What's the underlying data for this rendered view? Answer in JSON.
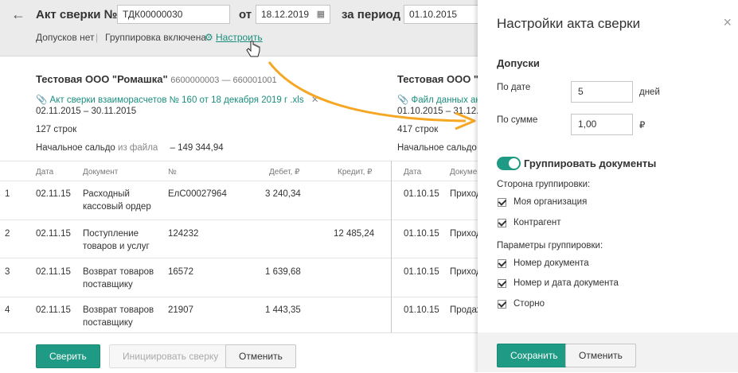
{
  "header": {
    "title": "Акт сверки №",
    "act_number": "ТДК00000030",
    "from_label": "от",
    "date": "18.12.2019",
    "period_label": "за период",
    "period_start": "01.10.2015",
    "tolerances_status": "Допусков нет",
    "separator": "|",
    "grouping_status": "Группировка включена",
    "configure_link": "Настроить"
  },
  "left_org": {
    "name": "Тестовая ООО \"Ромашка\"",
    "inn": "6600000003 — 660001001",
    "file": "Акт сверки взаиморасчетов № 160 от 18 декабря 2019 г .xls",
    "period": "02.11.2015 – 30.11.2015",
    "rows": "127 строк",
    "balance_label": "Начальное сальдо",
    "balance_source": "из файла",
    "balance_value": "– 149 344,94"
  },
  "right_org": {
    "name": "Тестовая ООО \"В",
    "file": "Файл данных акт",
    "period": "01.10.2015 – 31.12.20",
    "rows": "417 строк",
    "balance_label": "Начальное сальдо и"
  },
  "table": {
    "headers": [
      "Дата",
      "Документ",
      "№",
      "Дебет, ₽",
      "Кредит, ₽",
      "Дата",
      "Докумен"
    ],
    "rows": [
      {
        "n": "1",
        "date": "02.11.15",
        "doc1": "Расходный",
        "doc2": "кассовый ордер",
        "num": "ЕлС00027964",
        "debit": "3 240,34",
        "credit": "",
        "rdate": "01.10.15",
        "rdoc": "Приход"
      },
      {
        "n": "2",
        "date": "02.11.15",
        "doc1": "Поступление",
        "doc2": "товаров и услуг",
        "num": "124232",
        "debit": "",
        "credit": "12 485,24",
        "rdate": "01.10.15",
        "rdoc": "Приход"
      },
      {
        "n": "3",
        "date": "02.11.15",
        "doc1": "Возврат товаров",
        "doc2": "поставщику",
        "num": "16572",
        "debit": "1 639,68",
        "credit": "",
        "rdate": "01.10.15",
        "rdoc": "Приход"
      },
      {
        "n": "4",
        "date": "02.11.15",
        "doc1": "Возврат товаров",
        "doc2": "поставщику",
        "num": "21907",
        "debit": "1 443,35",
        "credit": "",
        "rdate": "01.10.15",
        "rdoc": "Продаж"
      }
    ]
  },
  "footer": {
    "reconcile": "Сверить",
    "initiate": "Инициировать сверку",
    "cancel": "Отменить"
  },
  "panel": {
    "title": "Настройки акта сверки",
    "close": "×",
    "tolerances_heading": "Допуски",
    "by_date_label": "По дате",
    "by_date_value": "5",
    "by_date_unit": "дней",
    "by_sum_label": "По сумме",
    "by_sum_value": "1,00",
    "by_sum_unit": "₽",
    "group_toggle_label": "Группировать документы",
    "group_side_label": "Сторона группировки:",
    "my_org": "Моя организация",
    "counterparty": "Контрагент",
    "group_params_label": "Параметры группировки:",
    "doc_number": "Номер документа",
    "doc_number_date": "Номер и дата документа",
    "storno": "Сторно",
    "save": "Сохранить",
    "cancel": "Отменить"
  },
  "colors": {
    "accent": "#1f9a84",
    "annotation_arrow": "#f5a623"
  }
}
